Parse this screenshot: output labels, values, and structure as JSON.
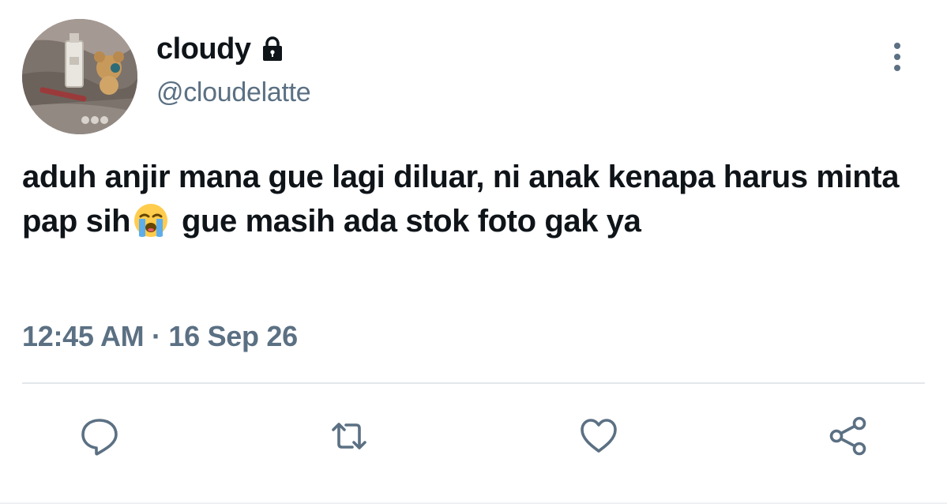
{
  "tweet": {
    "avatar_icon": "profile-photo",
    "display_name": "cloudy",
    "protected_icon": "lock-icon",
    "handle": "@cloudelatte",
    "text_before_emoji": "aduh anjir mana gue lagi diluar, ni anak kenapa harus minta pap sih",
    "emoji": "loudly-crying-face",
    "text_after_emoji": " gue masih ada stok foto gak ya",
    "timestamp": "12:45 AM · 16 Sep 26"
  },
  "actions": [
    {
      "name": "reply",
      "icon": "speech-bubble-icon"
    },
    {
      "name": "retweet",
      "icon": "retweet-icon"
    },
    {
      "name": "like",
      "icon": "heart-icon"
    },
    {
      "name": "share",
      "icon": "share-icon"
    }
  ],
  "colors": {
    "text_primary": "#0f1419",
    "text_secondary": "#5b7083",
    "divider": "#e3e7ea"
  }
}
